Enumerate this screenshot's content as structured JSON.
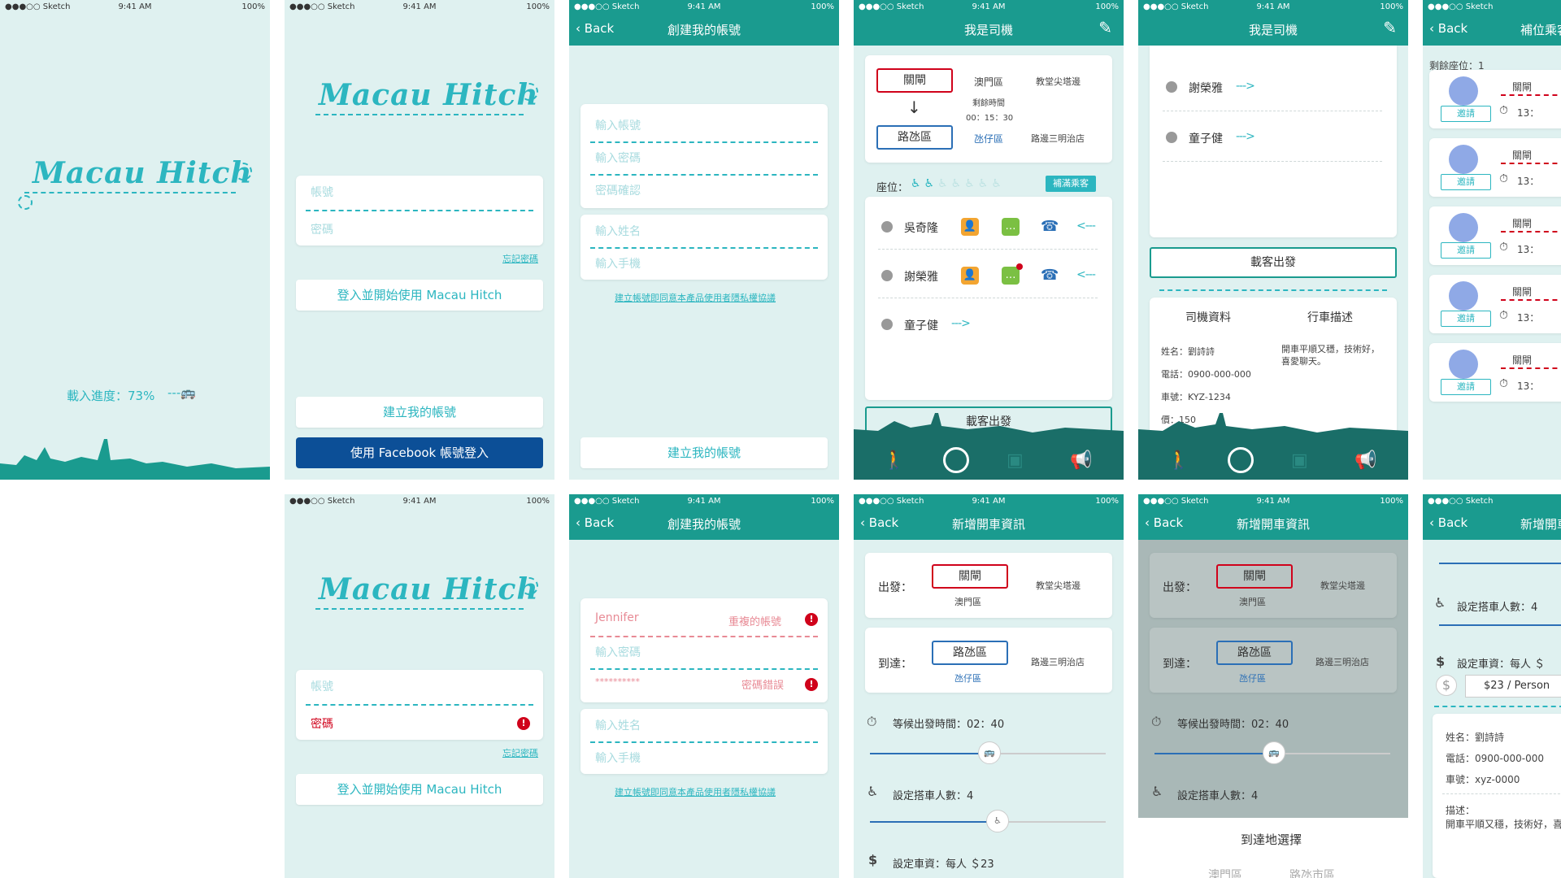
{
  "status": {
    "carrier": "●●●○○ Sketch",
    "time": "9:41 AM",
    "battery": "100%"
  },
  "app": {
    "logo": "Macau Hitch"
  },
  "splash": {
    "progress_label": "載入進度：73%",
    "progress": 0.73
  },
  "login": {
    "account_placeholder": "帳號",
    "password_placeholder": "密碼",
    "password_error": "密碼",
    "forgot": "忘記密碼",
    "login_button": "登入並開始使用 Macau Hitch",
    "create_button": "建立我的帳號",
    "facebook_button": "使用 Facebook 帳號登入"
  },
  "register": {
    "back": "Back",
    "title": "創建我的帳號",
    "account": "輸入帳號",
    "password": "輸入密碼",
    "confirm": "密碼確認",
    "name": "輸入姓名",
    "phone": "輸入手機",
    "terms": "建立帳號即同意本產品使用者隱私權協議",
    "create_button": "建立我的帳號",
    "filled_name": "Jennifer",
    "dup_error": "重複的帳號",
    "masked_pw": "**********",
    "pw_error": "密碼錯誤"
  },
  "driver": {
    "title": "我是司機",
    "from": "關閘",
    "from_area": "澳門區",
    "from_spot": "教堂尖塔邊",
    "remaining_label": "剩餘時間",
    "remaining": "00：15：30",
    "to": "路氹區",
    "to_area": "氹仔區",
    "to_spot": "路邊三明治店",
    "seats_label": "座位：",
    "fill_button": "補滿乘客",
    "passengers": [
      "吳奇隆",
      "謝榮雅",
      "童子健"
    ],
    "depart_button": "載客出發",
    "tab_icons": [
      "walk-icon",
      "steering-wheel-icon",
      "profile-icon",
      "megaphone-icon"
    ]
  },
  "driver2": {
    "passengers": [
      "謝榮雅",
      "童子健"
    ],
    "depart_button": "載客出發",
    "info_title": "司機資料",
    "desc_title": "行車描述",
    "name": "姓名：劉詩詩",
    "phone": "電話：0900-000-000",
    "plate": "車號：KYZ-1234",
    "seats": "價：150",
    "desc": "開車平順又穩，技術好，喜愛聊天。"
  },
  "seatfill": {
    "back": "Back",
    "title": "補位乘客",
    "remaining": "剩餘座位：1",
    "invite": "邀請",
    "from": "關閘",
    "time": "13："
  },
  "newride": {
    "back": "Back",
    "title": "新增開車資訊",
    "depart_label": "出發：",
    "arrive_label": "到達：",
    "from": "關閘",
    "from_area": "澳門區",
    "from_spot": "教堂尖塔邊",
    "to": "路氹區",
    "to_area": "氹仔區",
    "to_spot": "路邊三明治店",
    "wait_label": "等候出發時間：02：40",
    "seat_label": "設定搭車人數：4",
    "fare_label": "設定車資：每人 ＄23",
    "dest_title": "到達地選擇",
    "dest_opts": [
      "澳門區",
      "路氹市區"
    ]
  },
  "newride3": {
    "seat_label": "設定搭車人數：4",
    "fare_label": "設定車資：每人 ＄",
    "fare_value": "$23 / Person",
    "name": "姓名：劉詩詩",
    "phone": "電話：0900-000-000",
    "plate": "車號：xyz-0000",
    "desc_label": "描述：",
    "desc": "開車平順又穩，技術好，喜愛聊天。"
  }
}
